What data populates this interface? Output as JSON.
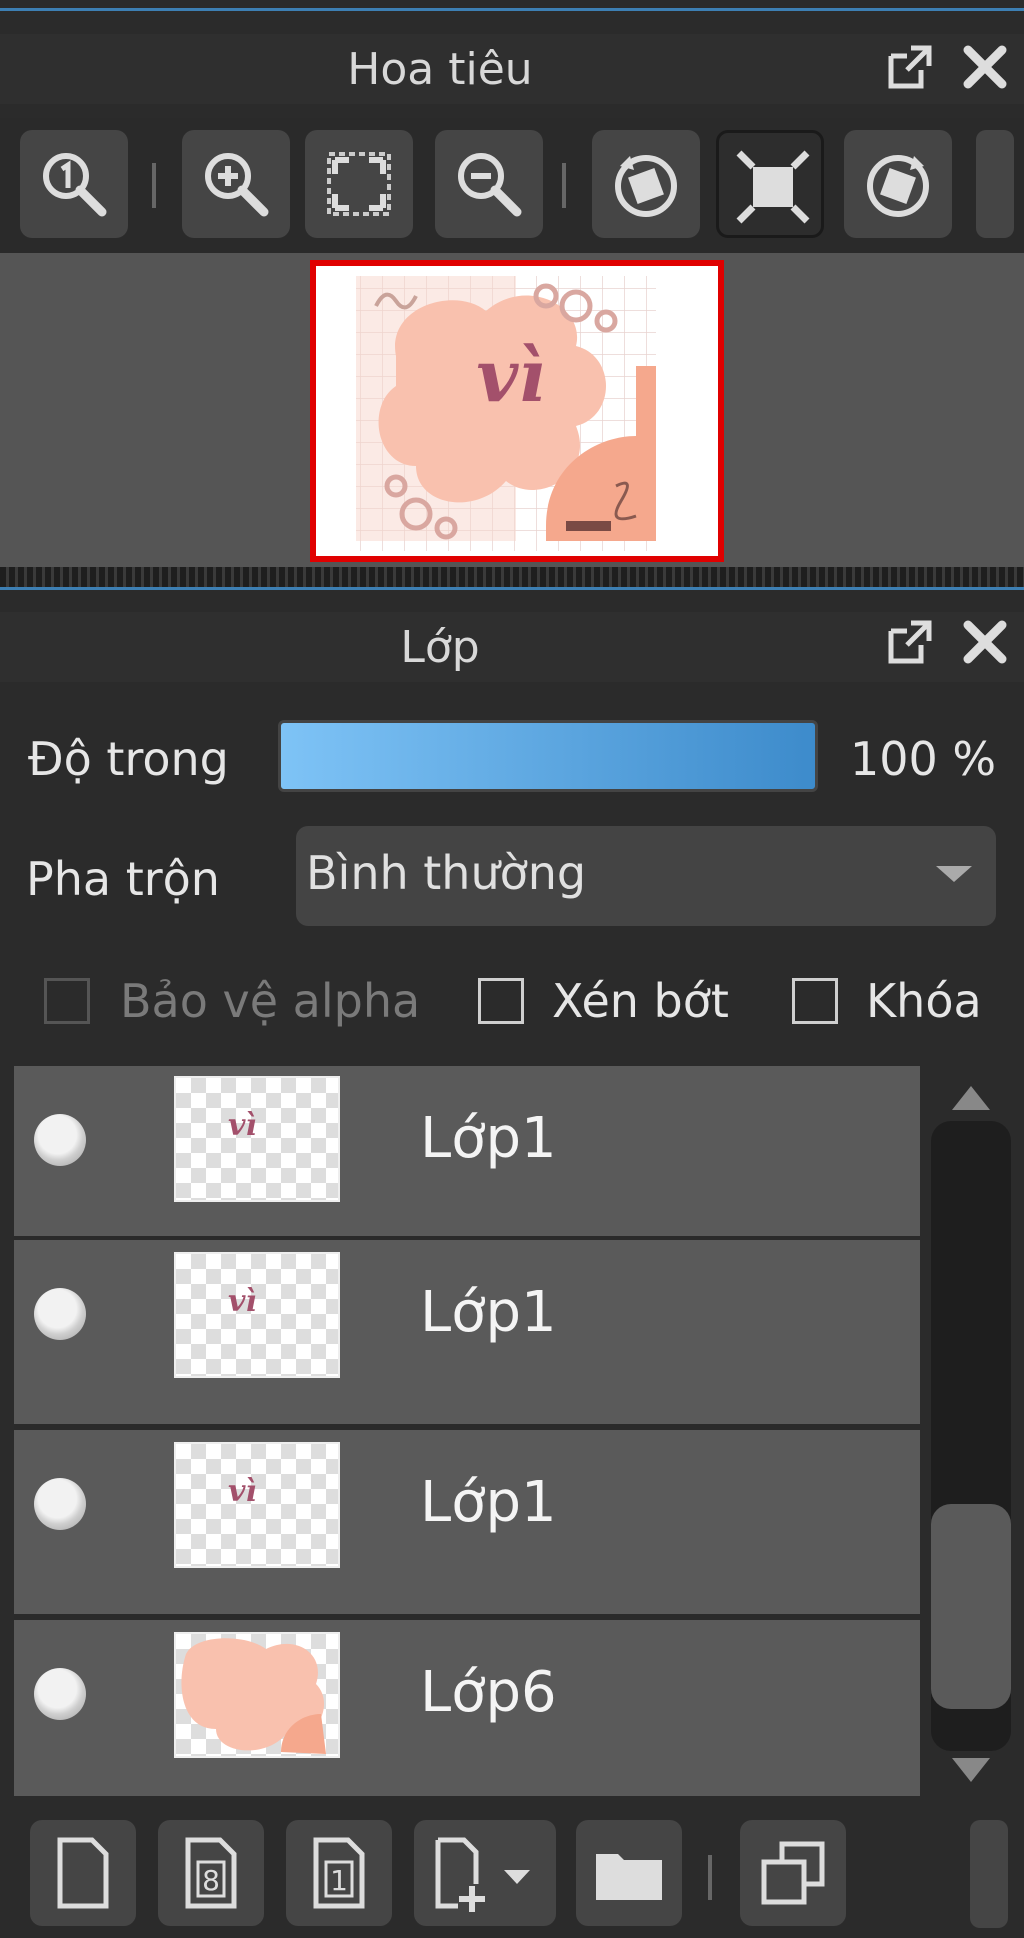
{
  "navigator": {
    "title": "Hoa tiêu",
    "toolbar_icons": [
      "zoom-actual-icon",
      "zoom-in-icon",
      "fit-window-icon",
      "zoom-out-icon",
      "rotate-left-icon",
      "reset-view-icon",
      "rotate-right-icon"
    ],
    "preview_text": "vì"
  },
  "layers": {
    "title": "Lớp",
    "opacity_label": "Độ trong",
    "opacity_value": "100 %",
    "opacity_fraction": 1.0,
    "blend_label": "Pha trộn",
    "blend_value": "Bình thường",
    "protect_alpha_label": "Bảo vệ alpha",
    "clipping_label": "Xén bớt",
    "lock_label": "Khóa",
    "items": [
      {
        "name": "Lớp1",
        "thumb": "text"
      },
      {
        "name": "Lớp1",
        "thumb": "text"
      },
      {
        "name": "Lớp1",
        "thumb": "text"
      },
      {
        "name": "Lớp6",
        "thumb": "shape"
      }
    ],
    "bottom_icons": [
      "new-layer-icon",
      "new-8bit-layer-icon",
      "new-1bit-layer-icon",
      "add-layer-menu-icon",
      "new-folder-icon",
      "duplicate-layer-icon"
    ]
  },
  "colors": {
    "accent": "#3d7fb3",
    "selection": "#e00000",
    "thumb_pink": "#f9c4b4",
    "text_mauve": "#a3506b"
  }
}
